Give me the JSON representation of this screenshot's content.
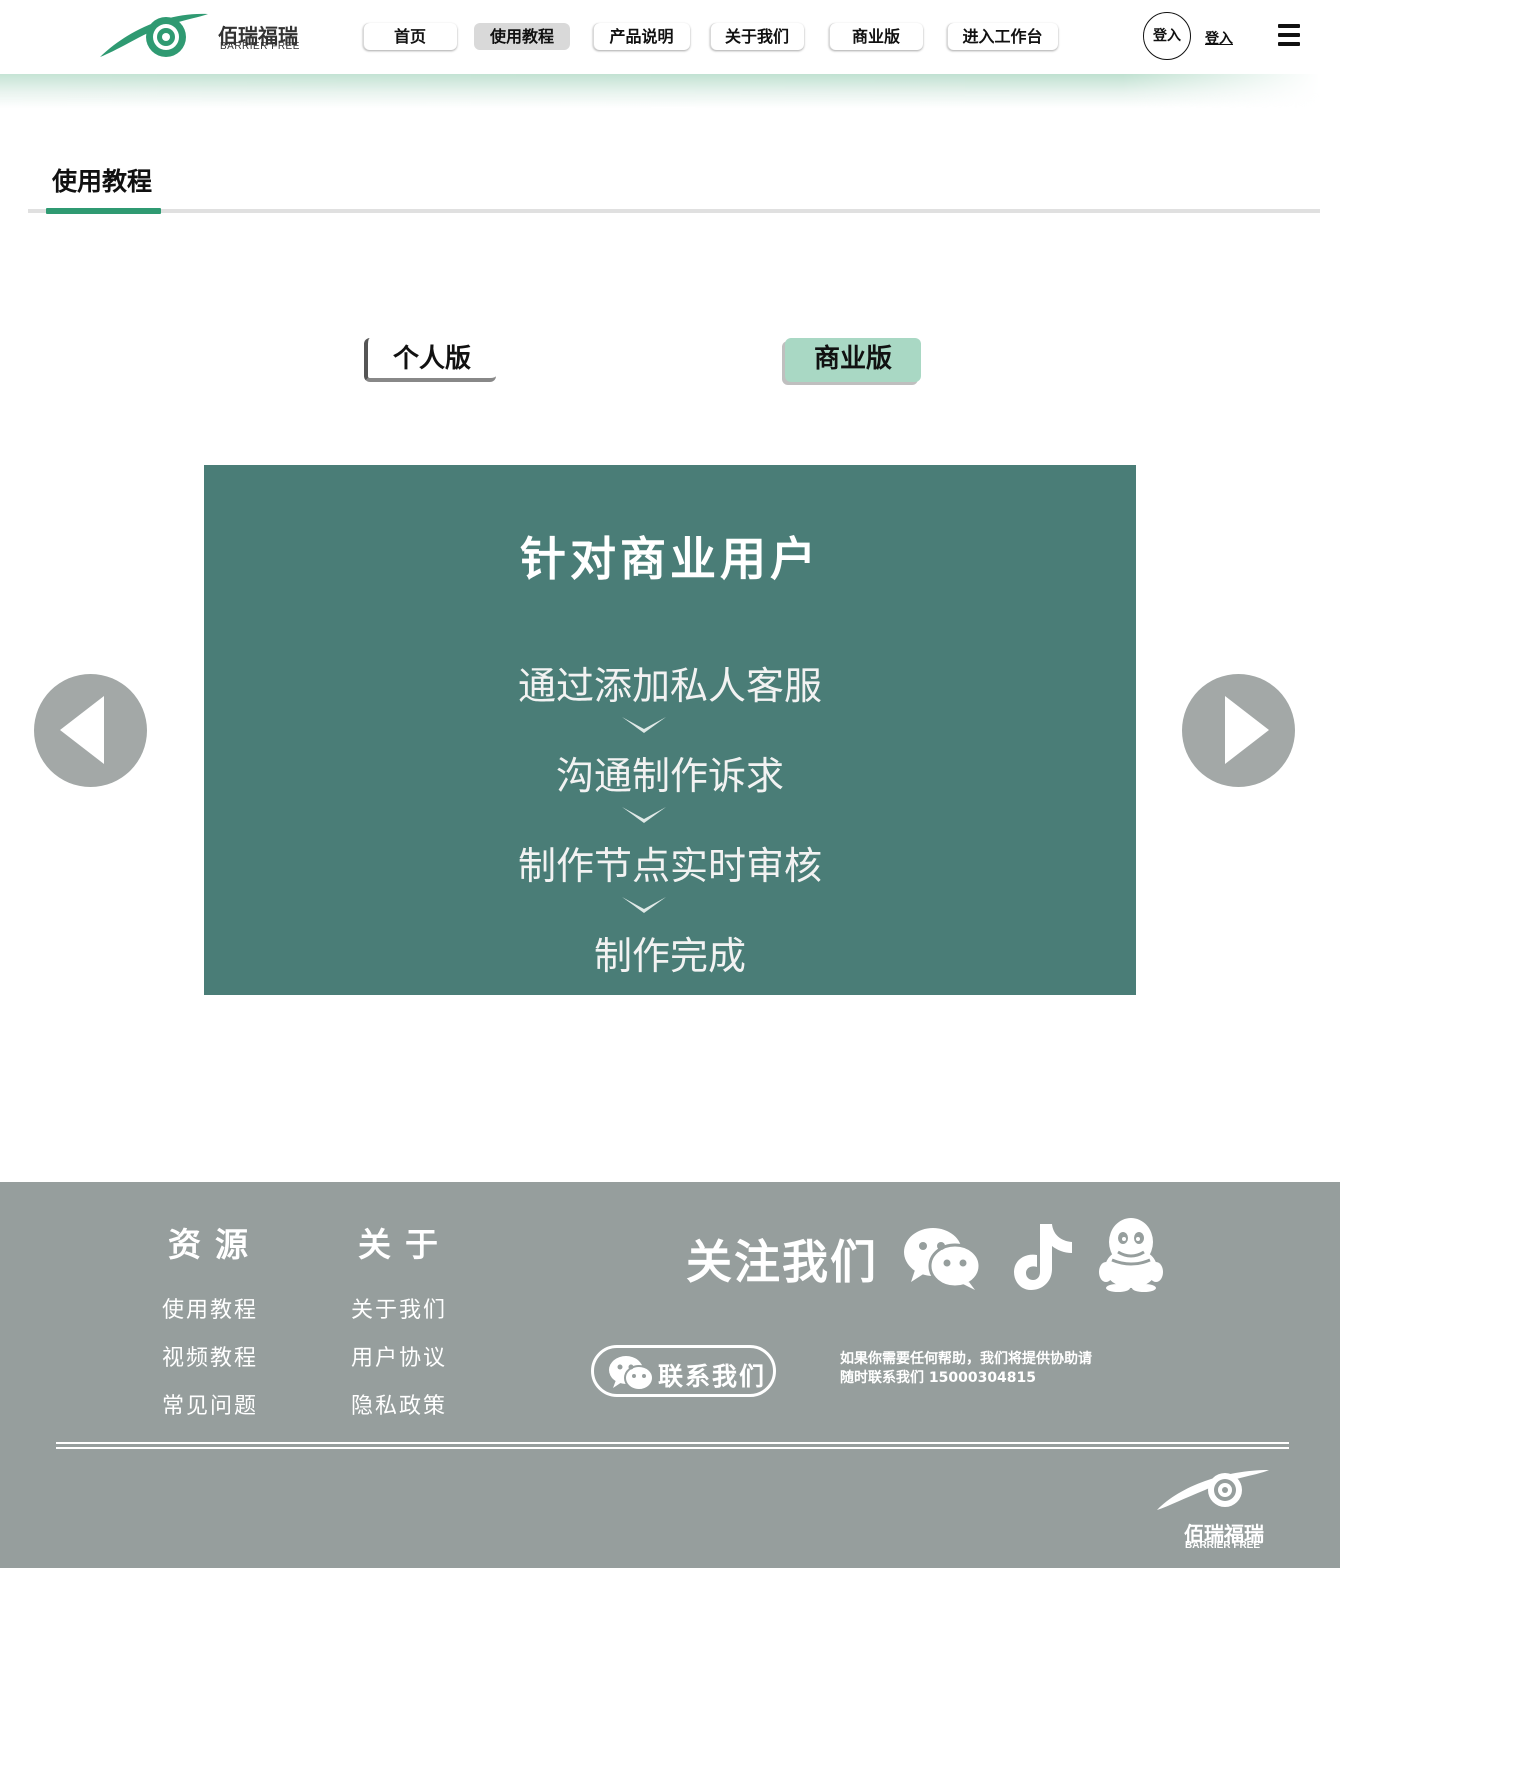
{
  "brand": {
    "name_cn": "佰瑞福瑞",
    "name_en": "BARRIER FREE",
    "accent_color": "#2f9a72",
    "slide_color": "#4a7d77",
    "footer_color": "#969e9d"
  },
  "nav": {
    "items": [
      {
        "label": "首页",
        "active": false
      },
      {
        "label": "使用教程",
        "active": true
      },
      {
        "label": "产品说明",
        "active": false
      },
      {
        "label": "关于我们",
        "active": false
      },
      {
        "label": "商业版",
        "active": false
      },
      {
        "label": "进入工作台",
        "active": false
      }
    ],
    "avatar_label": "登入",
    "login_label": "登入",
    "menu_icon": "hamburger-icon"
  },
  "page": {
    "title": "使用教程"
  },
  "versions": {
    "personal": "个人版",
    "business": "商业版",
    "selected": "商业版"
  },
  "slide": {
    "title": "针对商业用户",
    "steps": [
      "通过添加私人客服",
      "沟通制作诉求",
      "制作节点实时审核",
      "制作完成"
    ],
    "prev_icon": "triangle-left-icon",
    "next_icon": "triangle-right-icon"
  },
  "footer": {
    "resources": {
      "heading": "资源",
      "links": [
        "使用教程",
        "视频教程",
        "常见问题"
      ]
    },
    "about": {
      "heading": "关于",
      "links": [
        "关于我们",
        "用户协议",
        "隐私政策"
      ]
    },
    "follow_label": "关注我们",
    "social_icons": [
      "wechat-icon",
      "tiktok-icon",
      "qq-icon"
    ],
    "contact_label": "联系我们",
    "help_line1": "如果你需要任何帮助，我们将提供协助请",
    "help_line2": "随时联系我们 15000304815"
  }
}
